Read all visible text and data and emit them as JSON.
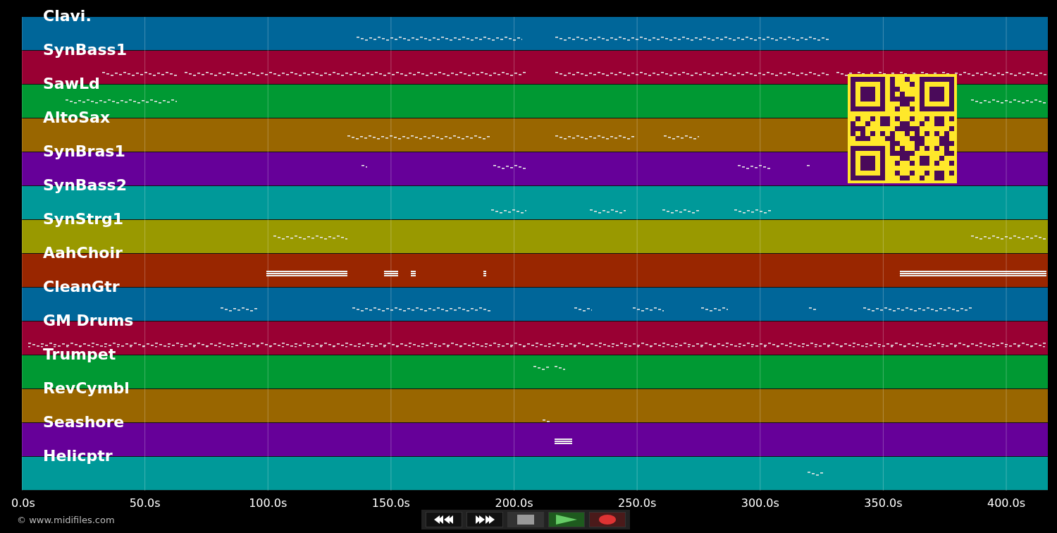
{
  "tracks": [
    {
      "name": "Clavi.",
      "color": "#006699"
    },
    {
      "name": "SynBass1",
      "color": "#990033"
    },
    {
      "name": "SawLd",
      "color": "#009933"
    },
    {
      "name": "AltoSax",
      "color": "#996600"
    },
    {
      "name": "SynBras1",
      "color": "#660099"
    },
    {
      "name": "SynBass2",
      "color": "#009999"
    },
    {
      "name": "SynStrg1",
      "color": "#999900"
    },
    {
      "name": "AahChoir",
      "color": "#992600"
    },
    {
      "name": "CleanGtr",
      "color": "#006699"
    },
    {
      "name": "GM Drums",
      "color": "#990033"
    },
    {
      "name": "Trumpet",
      "color": "#009933"
    },
    {
      "name": "RevCymbl",
      "color": "#996600"
    },
    {
      "name": "Seashore",
      "color": "#660099"
    },
    {
      "name": "Helicptr",
      "color": "#009999"
    }
  ],
  "time_axis": {
    "ticks": [
      "0.0s",
      "50.0s",
      "100.0s",
      "150.0s",
      "200.0s",
      "250.0s",
      "300.0s",
      "350.0s",
      "400.0s"
    ]
  },
  "transport": {
    "buttons": [
      {
        "kind": "rewind"
      },
      {
        "kind": "forward"
      },
      {
        "kind": "stop"
      },
      {
        "kind": "play"
      },
      {
        "kind": "record"
      }
    ]
  },
  "footer": {
    "copyright": "© www.midifiles.com"
  }
}
